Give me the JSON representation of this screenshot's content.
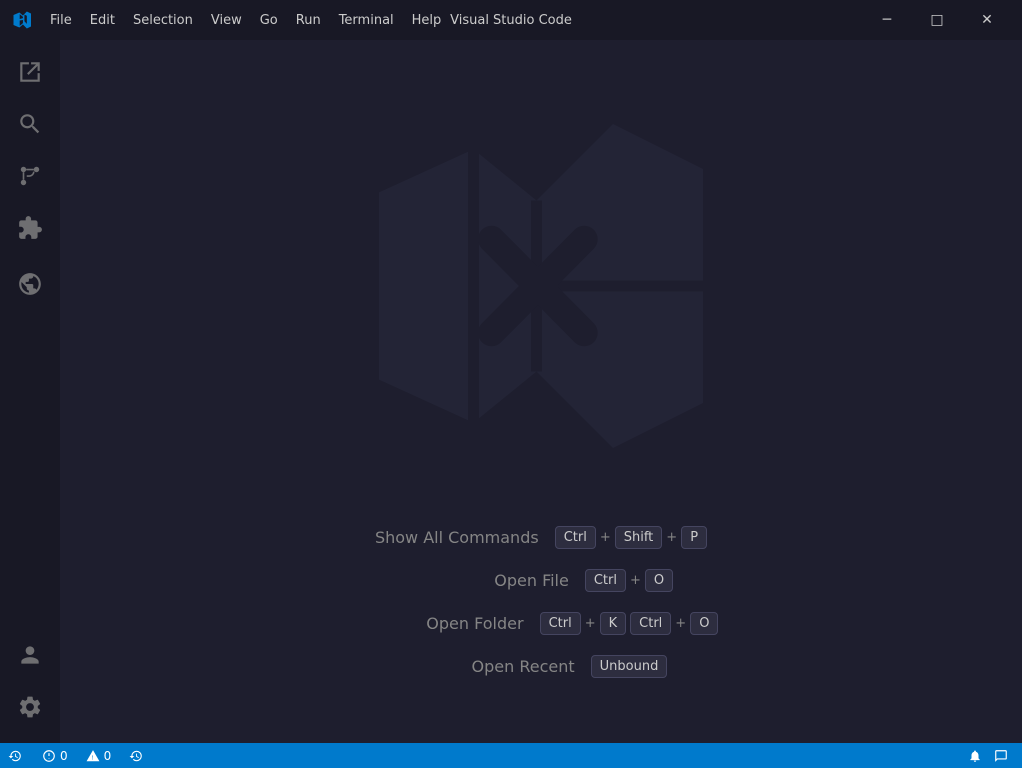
{
  "titlebar": {
    "app_name": "Visual Studio Code",
    "menu_items": [
      "File",
      "Edit",
      "Selection",
      "View",
      "Go",
      "Run",
      "Terminal",
      "Help"
    ],
    "win_minimize": "─",
    "win_restore": "□",
    "win_close": "✕"
  },
  "activity_bar": {
    "items": [
      {
        "name": "explorer-icon",
        "label": "Explorer"
      },
      {
        "name": "search-icon",
        "label": "Search"
      },
      {
        "name": "source-control-icon",
        "label": "Source Control"
      },
      {
        "name": "extensions-icon",
        "label": "Extensions"
      },
      {
        "name": "remote-explorer-icon",
        "label": "Remote Explorer"
      }
    ],
    "bottom_items": [
      {
        "name": "accounts-icon",
        "label": "Accounts"
      },
      {
        "name": "settings-icon",
        "label": "Settings"
      }
    ]
  },
  "shortcuts": [
    {
      "label": "Show All Commands",
      "keys": [
        {
          "group": [
            "Ctrl",
            "+",
            "Shift",
            "+",
            "P"
          ]
        }
      ]
    },
    {
      "label": "Open File",
      "keys": [
        {
          "group": [
            "Ctrl",
            "+",
            "O"
          ]
        }
      ]
    },
    {
      "label": "Open Folder",
      "keys": [
        {
          "group": [
            "Ctrl",
            "+",
            "K",
            "Ctrl",
            "+",
            "O"
          ]
        }
      ]
    },
    {
      "label": "Open Recent",
      "keys": [
        {
          "group": [
            "Unbound"
          ]
        }
      ]
    }
  ],
  "statusbar": {
    "remote_icon": "⚡",
    "remote_label": "",
    "error_count": "0",
    "warning_count": "0",
    "history_label": ""
  }
}
